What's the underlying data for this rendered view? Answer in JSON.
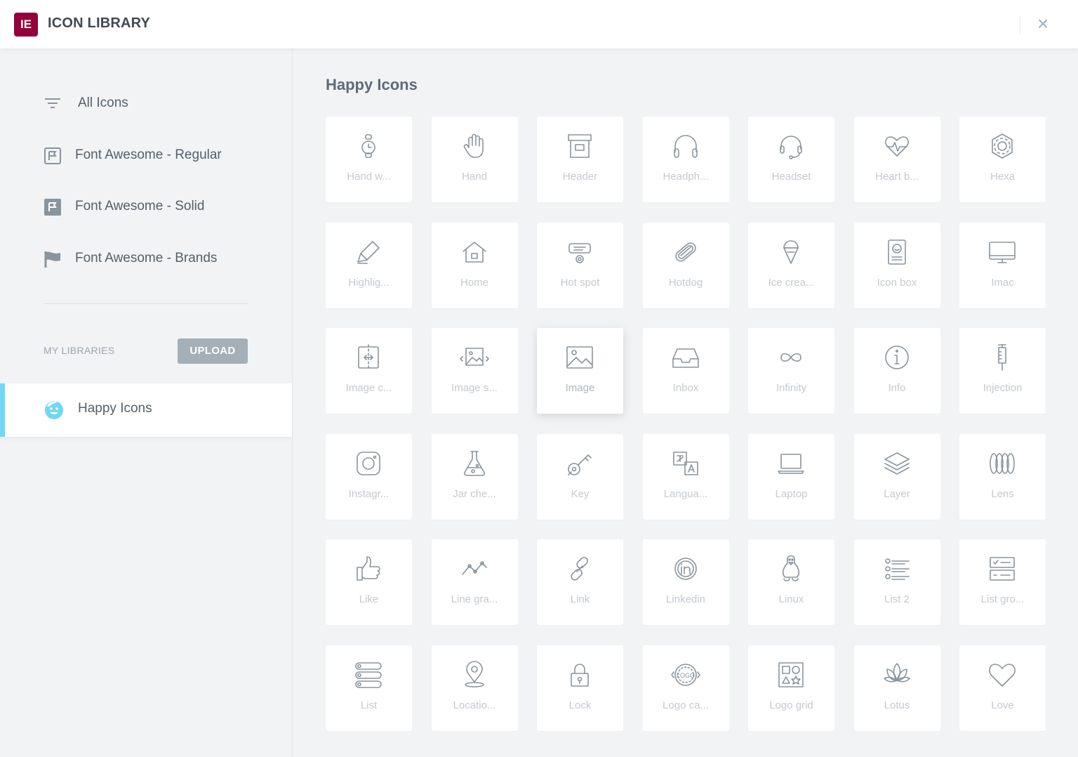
{
  "header": {
    "logo_text": "IE",
    "title": "ICON LIBRARY",
    "close_glyph": "×"
  },
  "sidebar": {
    "items": [
      {
        "label": "All Icons",
        "icon": "filter-lines-icon"
      },
      {
        "label": "Font Awesome - Regular",
        "icon": "flag-outline-icon"
      },
      {
        "label": "Font Awesome - Solid",
        "icon": "flag-solid-icon"
      },
      {
        "label": "Font Awesome - Brands",
        "icon": "flag-brand-icon"
      }
    ],
    "my_libraries_label": "MY LIBRARIES",
    "upload_label": "UPLOAD",
    "active_library": {
      "label": "Happy Icons",
      "icon": "happy-face-icon",
      "accent": "#71d7f7"
    }
  },
  "main": {
    "section_title": "Happy Icons",
    "selected_icon": "Image",
    "icons": [
      "Hand w...",
      "Hand",
      "Header",
      "Headph...",
      "Headset",
      "Heart b...",
      "Hexa",
      "Highlig...",
      "Home",
      "Hot spot",
      "Hotdog",
      "Ice crea...",
      "Icon box",
      "Imac",
      "Image c...",
      "Image s...",
      "Image",
      "Inbox",
      "Infinity",
      "Info",
      "Injection",
      "Instagr...",
      "Jar che...",
      "Key",
      "Langua...",
      "Laptop",
      "Layer",
      "Lens",
      "Like",
      "Line gra...",
      "Link",
      "Linkedin",
      "Linux",
      "List 2",
      "List gro...",
      "List",
      "Locatio...",
      "Lock",
      "Logo ca...",
      "Logo grid",
      "Lotus",
      "Love"
    ]
  },
  "colors": {
    "brand": "#93003c",
    "accent": "#71d7f7",
    "upload_bg": "#a4afb7"
  }
}
